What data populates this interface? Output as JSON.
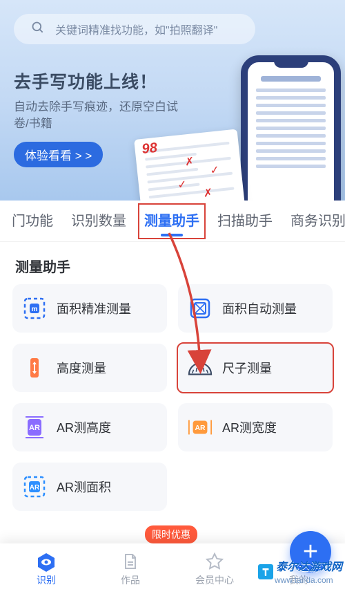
{
  "search": {
    "placeholder": "关键词精准找功能，如\"拍照翻译\""
  },
  "banner": {
    "title": "去手写功能上线！",
    "subtitle": "自动去除手写痕迹，还原空白试卷/书籍",
    "cta": "体验看看 > >"
  },
  "tabs": {
    "items": [
      {
        "label": "门功能",
        "active": false
      },
      {
        "label": "识别数量",
        "active": false
      },
      {
        "label": "测量助手",
        "active": true
      },
      {
        "label": "扫描助手",
        "active": false
      },
      {
        "label": "商务识别",
        "active": false
      }
    ]
  },
  "section": {
    "title": "测量助手"
  },
  "cards": [
    {
      "id": "area-precise",
      "label": "面积精准测量",
      "icon": "area-precise-icon",
      "color": "#2d6ff3"
    },
    {
      "id": "area-auto",
      "label": "面积自动测量",
      "icon": "area-auto-icon",
      "color": "#2d6ff3"
    },
    {
      "id": "height",
      "label": "高度测量",
      "icon": "height-icon",
      "color": "#ff7a45"
    },
    {
      "id": "ruler",
      "label": "尺子测量",
      "icon": "ruler-icon",
      "color": "#3b4a63",
      "highlight": true
    },
    {
      "id": "ar-height",
      "label": "AR测高度",
      "icon": "ar-height-icon",
      "color": "#8a6cff"
    },
    {
      "id": "ar-width",
      "label": "AR测宽度",
      "icon": "ar-width-icon",
      "color": "#ff9a3c"
    },
    {
      "id": "ar-area",
      "label": "AR测面积",
      "icon": "ar-area-icon",
      "color": "#2d8fff"
    }
  ],
  "promo": {
    "label": "限时优惠"
  },
  "bottom_nav": {
    "items": [
      {
        "id": "recognize",
        "label": "识别",
        "active": true
      },
      {
        "id": "works",
        "label": "作品",
        "active": false
      },
      {
        "id": "member",
        "label": "会员中心",
        "active": false
      },
      {
        "id": "mine",
        "label": "我的",
        "active": false
      }
    ]
  },
  "watermark": {
    "brand": "泰尔达游戏网",
    "url": "www.tairda.com"
  }
}
